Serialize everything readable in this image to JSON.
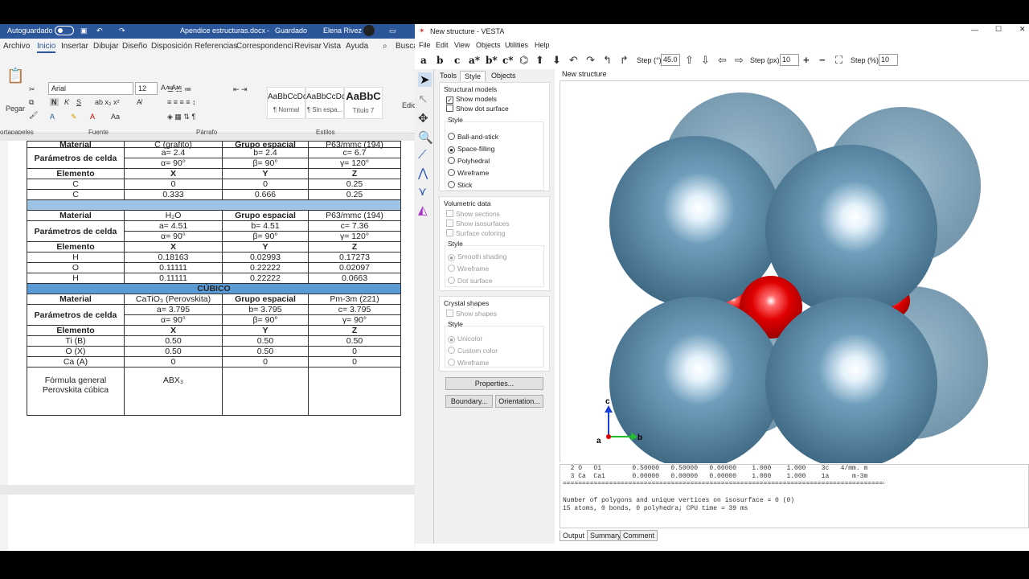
{
  "word": {
    "title": {
      "autosave": "Autoguardado",
      "doc": "Apendice estructuras.docx",
      "status": "Guardado",
      "user": "Elena Rivez"
    },
    "menu": [
      "Archivo",
      "Inicio",
      "Insertar",
      "Dibujar",
      "Diseño",
      "Disposición",
      "Referencias",
      "Correspondenci",
      "Revisar",
      "Vista",
      "Ayuda",
      "Busca"
    ],
    "ribbon": {
      "paste": "Pegar",
      "font": "Arial",
      "size": "12",
      "bold": "N",
      "italic": "K",
      "underline": "S",
      "groups": {
        "clipboard": "ortapapeles",
        "font": "Fuente",
        "paragraph": "Párrafo",
        "styles": "Estilos"
      },
      "edit": "Edic",
      "styles": [
        {
          "preview": "AaBbCcDc",
          "name": "¶ Normal"
        },
        {
          "preview": "AaBbCcDc",
          "name": "¶ Sin espa..."
        },
        {
          "preview": "AaBbC",
          "name": "Título 7"
        }
      ]
    },
    "table": {
      "r0": [
        "Material",
        "C (grafito)",
        "Grupo espacial",
        "P63/mmc (194)"
      ],
      "r1": [
        "Parámetros de celda",
        "a= 2.4",
        "b= 2.4",
        "c= 6.7"
      ],
      "r1b": [
        "α= 90°",
        "β= 90°",
        "γ= 120°"
      ],
      "r2": [
        "Elemento",
        "X",
        "Y",
        "Z"
      ],
      "r3": [
        "C",
        "0",
        "0",
        "0.25"
      ],
      "r4": [
        "C",
        "0.333",
        "0.666",
        "0.25"
      ],
      "r5": [
        "Material",
        "H₂O",
        "Grupo espacial",
        "P63/mmc  (194)"
      ],
      "r6": [
        "Parámetros de celda",
        "a= 4.51",
        "b= 4.51",
        "c= 7.36"
      ],
      "r6b": [
        "α= 90°",
        "β= 90°",
        "γ= 120°"
      ],
      "r7": [
        "Elemento",
        "X",
        "Y",
        "Z"
      ],
      "r8": [
        "H",
        "0.18163",
        "0.02993",
        "0.17273"
      ],
      "r9": [
        "O",
        "0.11111",
        "0.22222",
        "0.02097"
      ],
      "r10": [
        "H",
        "0.11111",
        "0.22222",
        "0.0663"
      ],
      "r11": "CÚBICO",
      "r12": [
        "Material",
        "CaTiO₃ (Perovskita)",
        "Grupo espacial",
        "Pm-3m (221)"
      ],
      "r13": [
        "Parámetros de celda",
        "a= 3.795",
        "b= 3.795",
        "c= 3.795"
      ],
      "r13b": [
        "α= 90°",
        "β= 90°",
        "γ= 90°"
      ],
      "r14": [
        "Elemento",
        "X",
        "Y",
        "Z"
      ],
      "r15": [
        "Ti (B)",
        "0.50",
        "0.50",
        "0.50"
      ],
      "r16": [
        "O (X)",
        "0.50",
        "0.50",
        "0"
      ],
      "r17": [
        "Ca (A)",
        "0",
        "0",
        "0"
      ],
      "r18": [
        "Fórmula general\nPerovskita cúbica",
        "ABX₃",
        "",
        ""
      ]
    }
  },
  "vesta": {
    "title": "New structure - VESTA",
    "menu": [
      "File",
      "Edit",
      "View",
      "Objects",
      "Utilities",
      "Help"
    ],
    "toolbar": {
      "axes": [
        "a",
        "b",
        "c",
        "a*",
        "b*",
        "c*"
      ],
      "step_deg_label": "Step (°):",
      "step_deg": "45.0",
      "step_px_label": "Step (px):",
      "step_px": "10",
      "step_pct_label": "Step (%):",
      "step_pct": "10"
    },
    "panel_tabs": [
      "Tools",
      "Style",
      "Objects"
    ],
    "structural": {
      "title": "Structural models",
      "show_models": "Show models",
      "show_dot": "Show dot surface",
      "style_title": "Style",
      "options": [
        "Ball-and-stick",
        "Space-filling",
        "Polyhedral",
        "Wireframe",
        "Stick"
      ]
    },
    "volumetric": {
      "title": "Volumetric data",
      "items": [
        "Show sections",
        "Show isosurfaces",
        "Surface coloring"
      ],
      "style_title": "Style",
      "options": [
        "Smooth shading",
        "Wireframe",
        "Dot surface"
      ]
    },
    "crystal": {
      "title": "Crystal shapes",
      "show_shapes": "Show shapes",
      "style_title": "Style",
      "options": [
        "Unicolor",
        "Custom color",
        "Wireframe"
      ]
    },
    "buttons": {
      "properties": "Properties...",
      "boundary": "Boundary...",
      "orientation": "Orientation..."
    },
    "view_tab": "New structure",
    "axis_labels": {
      "a": "a",
      "b": "b",
      "c": "c"
    },
    "output": {
      "lines": [
        "  2 O   O1        0.50000   0.50000   0.00000    1.000    1.000    3c   4/mm. m",
        "  3 Ca  Ca1       0.00000   0.00000   0.00000    1.000    1.000    1a      m-3m",
        "======================================================================================",
        "",
        "Number of polygons and unique vertices on isosurface = 0 (0)",
        "15 atoms, 0 bonds, 0 polyhedra; CPU time = 39 ms"
      ],
      "tabs": [
        "Output",
        "Summary",
        "Comment"
      ]
    },
    "colors": {
      "ca": "#5e8fae",
      "o": "#e00000"
    }
  }
}
